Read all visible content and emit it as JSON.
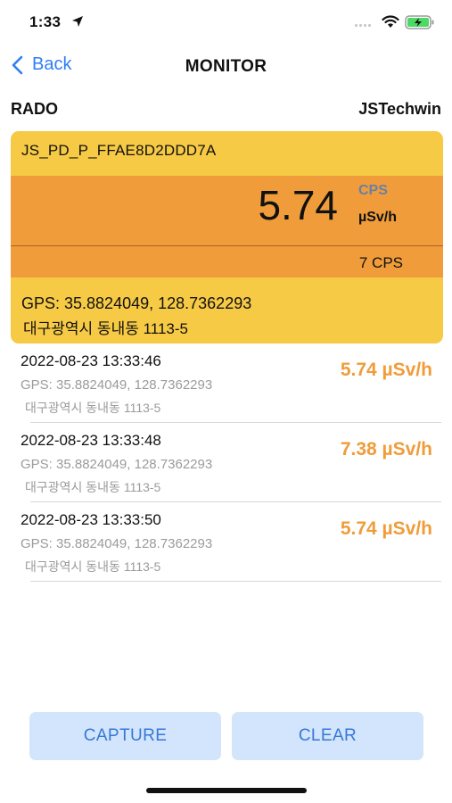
{
  "status_bar": {
    "time": "1:33",
    "icons": [
      "location-arrow-icon",
      "signal-icon",
      "wifi-icon",
      "battery-charging-icon"
    ]
  },
  "nav": {
    "back_label": "Back",
    "title": "MONITOR"
  },
  "brand": {
    "left": "RADO",
    "right": "JSTechwin"
  },
  "card": {
    "device_id": "JS_PD_P_FFAE8D2DDD7A",
    "dose_value": "5.74",
    "cps_unit": "CPS",
    "dose_unit": "µSv/h",
    "cps_value": "7  CPS",
    "gps": "GPS: 35.8824049, 128.7362293",
    "address": "대구광역시  동내동  1113-5"
  },
  "history": [
    {
      "time": "2022-08-23 13:33:46",
      "gps": "GPS: 35.8824049, 128.7362293",
      "address": "대구광역시  동내동  1113-5",
      "dose": "5.74 µSv/h"
    },
    {
      "time": "2022-08-23 13:33:48",
      "gps": "GPS: 35.8824049, 128.7362293",
      "address": "대구광역시  동내동  1113-5",
      "dose": "7.38 µSv/h"
    },
    {
      "time": "2022-08-23 13:33:50",
      "gps": "GPS: 35.8824049, 128.7362293",
      "address": "대구광역시  동내동  1113-5",
      "dose": "5.74 µSv/h"
    }
  ],
  "buttons": {
    "capture": "CAPTURE",
    "clear": "CLEAR"
  },
  "colors": {
    "accent_blue": "#2f7df6",
    "card_yellow": "#f7ca45",
    "reading_orange": "#f09c3a",
    "button_bg": "#d2e5fc",
    "battery_green": "#4cd964"
  }
}
